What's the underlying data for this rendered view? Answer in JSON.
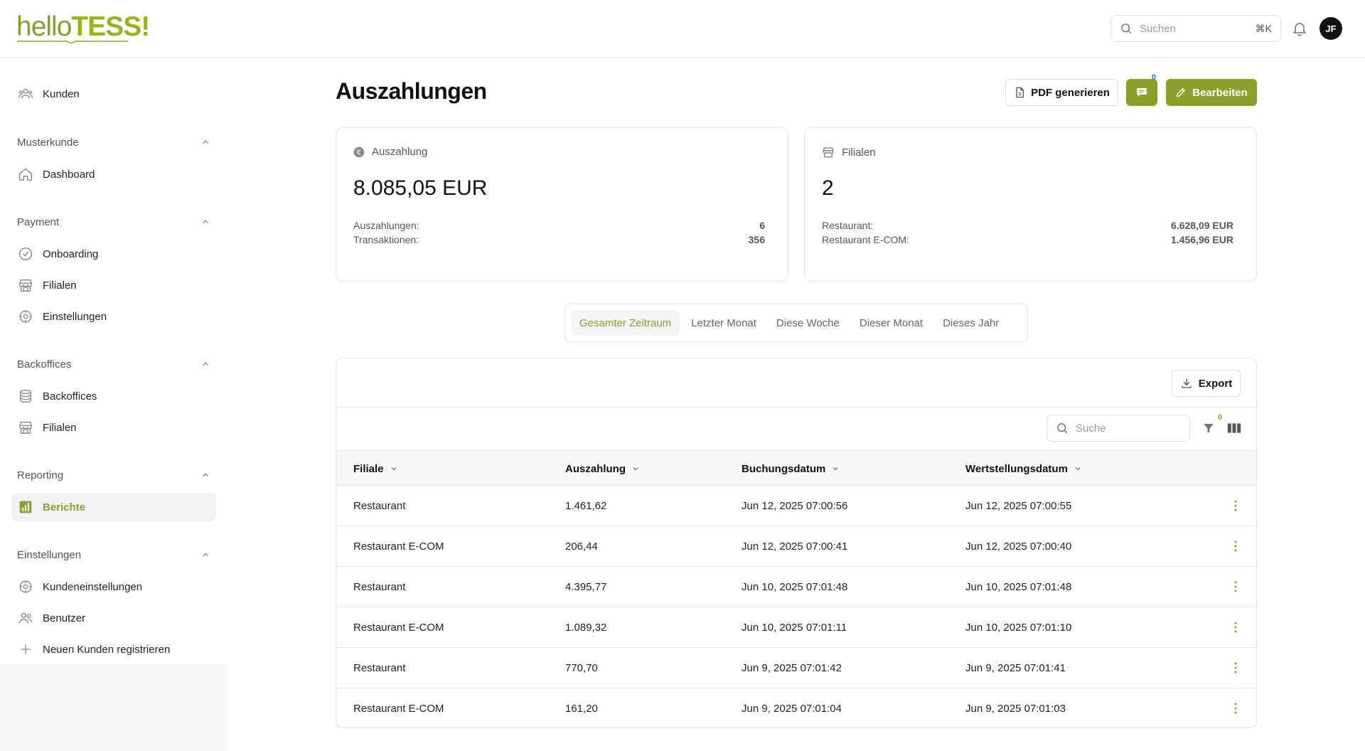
{
  "brand": {
    "hello": "hello",
    "tess": "TESS!"
  },
  "topbar": {
    "search_placeholder": "Suchen",
    "shortcut": "⌘K",
    "avatar_initials": "JF"
  },
  "sidebar": {
    "kunden": "Kunden",
    "sections": [
      {
        "title": "Musterkunde",
        "items": [
          "Dashboard"
        ]
      },
      {
        "title": "Payment",
        "items": [
          "Onboarding",
          "Filialen",
          "Einstellungen"
        ]
      },
      {
        "title": "Backoffices",
        "items": [
          "Backoffices",
          "Filialen"
        ]
      },
      {
        "title": "Reporting",
        "items": [
          "Berichte"
        ]
      },
      {
        "title": "Einstellungen",
        "items": [
          "Kundeneinstellungen",
          "Benutzer",
          "Neuen Kunden registrieren"
        ]
      }
    ]
  },
  "page": {
    "title": "Auszahlungen",
    "pdf_label": "PDF generieren",
    "chat_count": "0",
    "edit_label": "Bearbeiten"
  },
  "cards": {
    "payout": {
      "label": "Auszahlung",
      "value": "8.085,05 EUR",
      "rows": [
        {
          "label": "Auszahlungen:",
          "value": "6"
        },
        {
          "label": "Transaktionen:",
          "value": "356"
        }
      ]
    },
    "branches": {
      "label": "Filialen",
      "value": "2",
      "rows": [
        {
          "label": "Restaurant:",
          "value": "6.628,09 EUR"
        },
        {
          "label": "Restaurant E-COM:",
          "value": "1.456,96 EUR"
        }
      ]
    }
  },
  "period_tabs": [
    "Gesamter Zeitraum",
    "Letzter Monat",
    "Diese Woche",
    "Dieser Monat",
    "Dieses Jahr"
  ],
  "table": {
    "export_label": "Export",
    "search_placeholder": "Suche",
    "filter_count": "0",
    "columns": [
      "Filiale",
      "Auszahlung",
      "Buchungsdatum",
      "Wertstellungsdatum"
    ],
    "rows": [
      [
        "Restaurant",
        "1.461,62",
        "Jun 12, 2025 07:00:56",
        "Jun 12, 2025 07:00:55"
      ],
      [
        "Restaurant E-COM",
        "206,44",
        "Jun 12, 2025 07:00:41",
        "Jun 12, 2025 07:00:40"
      ],
      [
        "Restaurant",
        "4.395,77",
        "Jun 10, 2025 07:01:48",
        "Jun 10, 2025 07:01:48"
      ],
      [
        "Restaurant E-COM",
        "1.089,32",
        "Jun 10, 2025 07:01:11",
        "Jun 10, 2025 07:01:10"
      ],
      [
        "Restaurant",
        "770,70",
        "Jun 9, 2025 07:01:42",
        "Jun 9, 2025 07:01:41"
      ],
      [
        "Restaurant E-COM",
        "161,20",
        "Jun 9, 2025 07:01:04",
        "Jun 9, 2025 07:01:03"
      ]
    ]
  },
  "colors": {
    "accent": "#8aa02a"
  }
}
